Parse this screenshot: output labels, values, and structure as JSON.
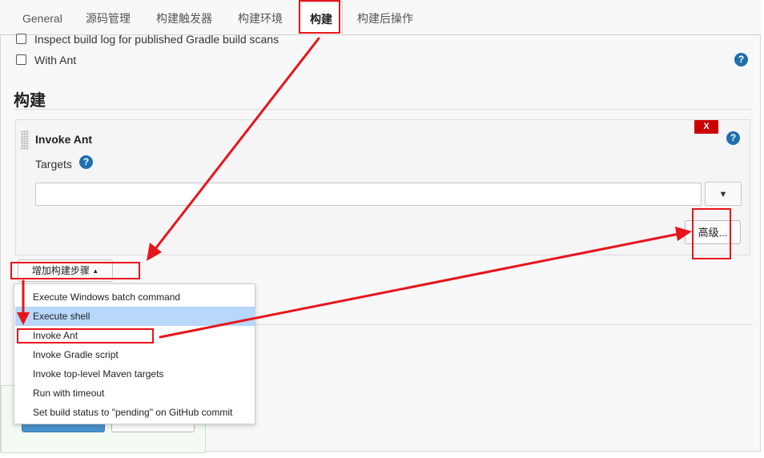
{
  "tabs": [
    {
      "label": "General"
    },
    {
      "label": "源码管理"
    },
    {
      "label": "构建触发器"
    },
    {
      "label": "构建环境"
    },
    {
      "label": "构建"
    },
    {
      "label": "构建后操作"
    }
  ],
  "options": {
    "inspect_log_label": "Inspect build log for published Gradle build scans",
    "with_ant_label": "With Ant"
  },
  "help_glyph": "?",
  "section_title": "构建",
  "step": {
    "title": "Invoke Ant",
    "delete_label": "X",
    "targets_label": "Targets",
    "targets_value": "",
    "expand_glyph": "▼",
    "advanced_label": "高级..."
  },
  "add_step_button": {
    "label": "增加构建步骤",
    "caret": "▲"
  },
  "dropdown": {
    "items": [
      {
        "label": "Execute Windows batch command"
      },
      {
        "label": "Execute shell"
      },
      {
        "label": "Invoke Ant"
      },
      {
        "label": "Invoke Gradle script"
      },
      {
        "label": "Invoke top-level Maven targets"
      },
      {
        "label": "Run with timeout"
      },
      {
        "label": "Set build status to \"pending\" on GitHub commit"
      }
    ],
    "highlighted": "Execute shell"
  },
  "colors": {
    "annotation_red": "#e8141b",
    "help_blue": "#1f6fae",
    "delete_red": "#cc0000",
    "highlight_blue": "#b7d7fb"
  },
  "icons": {
    "help": "question-circle-icon",
    "drag": "drag-handle-icon",
    "expand": "chevron-down-icon",
    "caret": "caret-up-icon"
  }
}
